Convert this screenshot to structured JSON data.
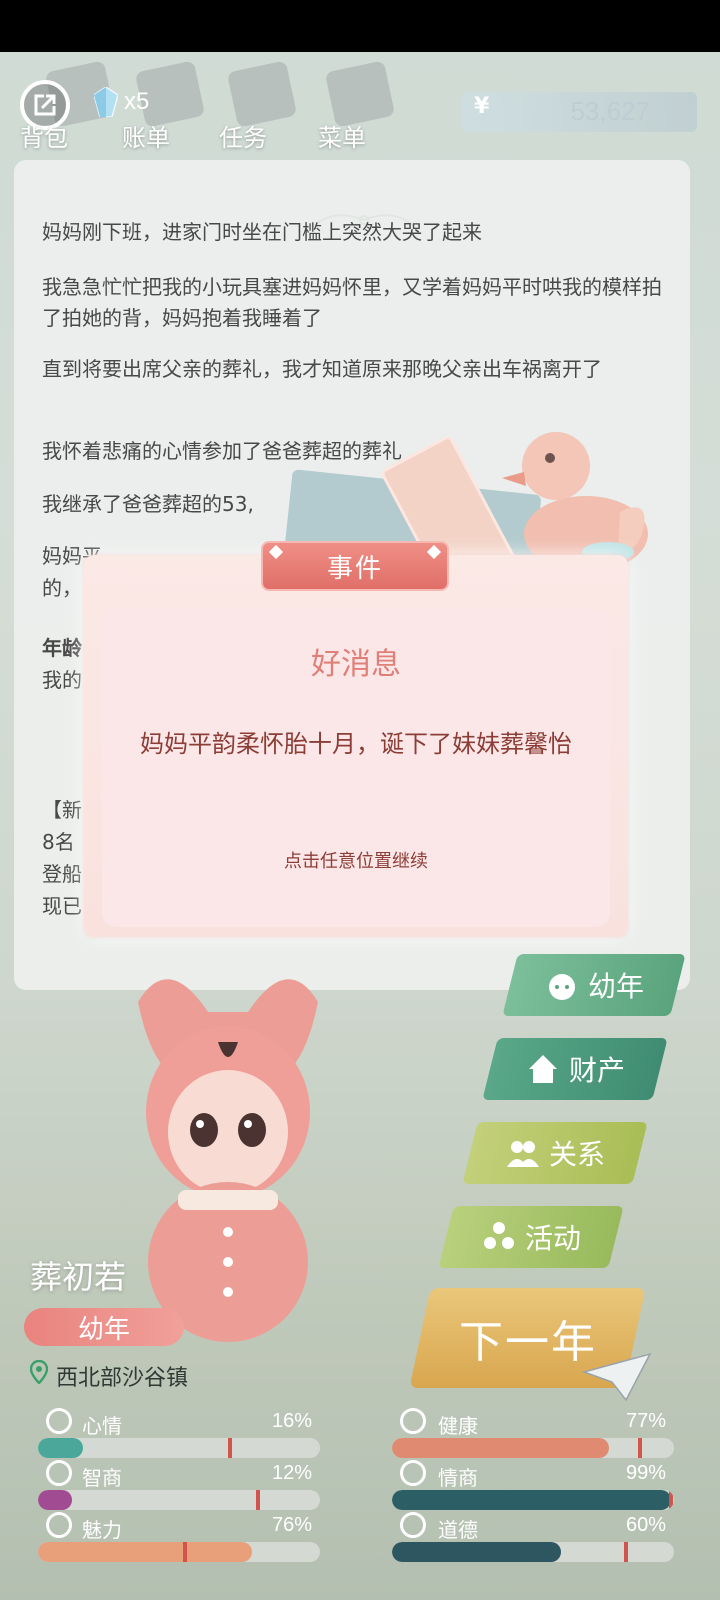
{
  "top_bar": {
    "gem_count": "x5",
    "tabs": [
      "背包",
      "账单",
      "任务",
      "菜单"
    ],
    "currency_symbol": "¥",
    "money": "53,627"
  },
  "log": [
    "妈妈刚下班，进家门时坐在门槛上突然大哭了起来",
    "我急急忙忙把我的小玩具塞进妈妈怀里，又学着妈妈平时哄我的模样拍了拍她的背，妈妈抱着我睡着了",
    "直到将要出席父亲的葬礼，我才知道原来那晚父亲出车祸离开了",
    "我怀着悲痛的心情参加了爸爸葬超的葬礼",
    "我继承了爸爸葬超的53,",
    "妈妈平",
    "的，",
    "年龄",
    "我的",
    "【新",
    "8名",
    "登船",
    "现已"
  ],
  "dialog": {
    "banner": "事件",
    "title": "好消息",
    "body": "妈妈平韵柔怀胎十月，诞下了妹妹葬馨怡",
    "hint": "点击任意位置继续"
  },
  "character": {
    "name": "葬初若",
    "stage": "幼年",
    "location": "西北部沙谷镇"
  },
  "side_menu": {
    "stage": "幼年",
    "assets": "财产",
    "relations": "关系",
    "activities": "活动",
    "next_year": "下一年"
  },
  "stats": [
    {
      "label": "心情",
      "pct": "16%",
      "value": 16,
      "color": "#4aa79a",
      "icon": "smile-icon"
    },
    {
      "label": "健康",
      "pct": "77%",
      "value": 77,
      "color": "#e08a72",
      "icon": "heart-icon"
    },
    {
      "label": "智商",
      "pct": "12%",
      "value": 12,
      "color": "#a14b93",
      "icon": "bulb-icon"
    },
    {
      "label": "情商",
      "pct": "99%",
      "value": 99,
      "color": "#2c5e66",
      "icon": "apple-icon"
    },
    {
      "label": "魅力",
      "pct": "76%",
      "value": 76,
      "color": "#e8a07a",
      "icon": "sparkle-icon"
    },
    {
      "label": "道德",
      "pct": "60%",
      "value": 60,
      "color": "#2e5660",
      "icon": "scale-icon"
    }
  ],
  "colors": {
    "accent_pink": "#e06f68",
    "dialog_text": "#8c3d36",
    "next_year_gold": "#d9a64f"
  }
}
